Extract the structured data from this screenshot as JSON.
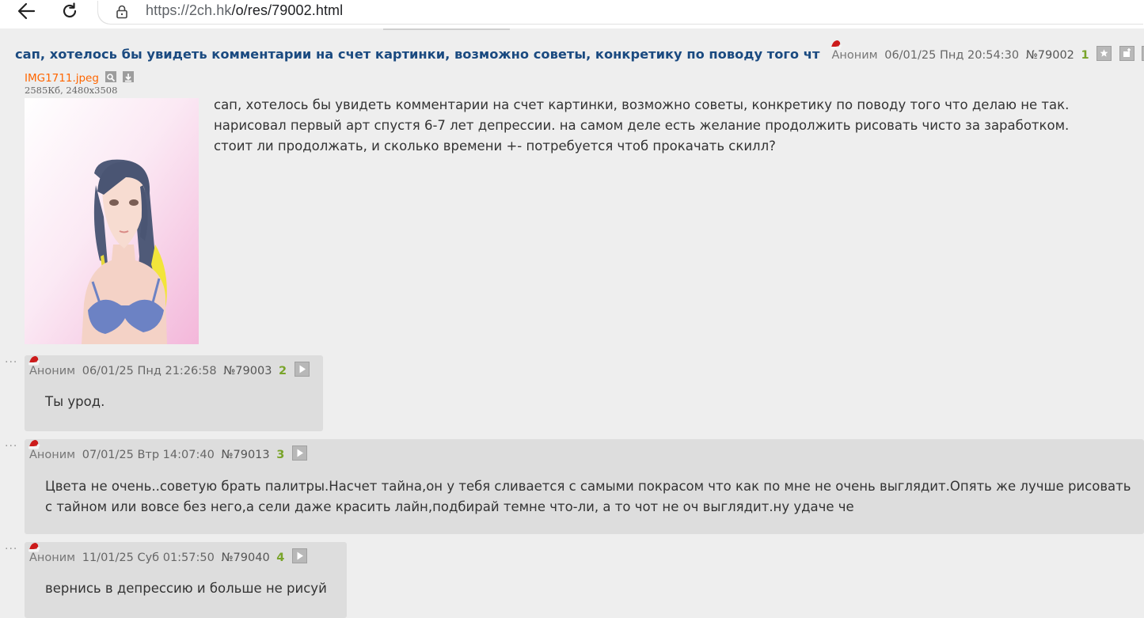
{
  "browser": {
    "url_host": "https://2ch.hk",
    "url_path": "/o/res/79002.html"
  },
  "op": {
    "subject": "сап, хотелось бы увидеть комментарии на счет картинки, возможно советы, конкретику по поводу того чт",
    "name": "Аноним",
    "datetime": "06/01/25 Пнд 20:54:30",
    "number": "№79002",
    "index": "1",
    "file_name": "IMG1711.jpeg",
    "file_size": "2585Кб, 2480x3508",
    "text": "сап, хотелось бы увидеть комментарии на счет картинки, возможно советы, конкретику по поводу того что делаю не так. нарисовал первый арт спустя 6-7 лет депрессии. на самом деле есть желание продолжить рисовать чисто за заработком. стоит ли продолжать, и сколько времени +- потребуется чтоб прокачать скилл?"
  },
  "replies": [
    {
      "name": "Аноним",
      "datetime": "06/01/25 Пнд 21:26:58",
      "number": "№79003",
      "index": "2",
      "text": "Ты урод."
    },
    {
      "name": "Аноним",
      "datetime": "07/01/25 Втр 14:07:40",
      "number": "№79013",
      "index": "3",
      "text": "Цвета не очень..советую брать палитры.Насчет тайна,он у тебя сливается с самыми покрасом что как по мне не очень выглядит.Опять же лучше рисовать с тайном или вовсе без него,а сели даже красить лайн,подбирай темне что-ли, а то чот не оч выглядит.ну удаче че"
    },
    {
      "name": "Аноним",
      "datetime": "11/01/25 Суб 01:57:50",
      "number": "№79040",
      "index": "4",
      "text": "вернись в депрессию и больше не рисуй"
    }
  ],
  "icons": {
    "back": "arrow-left-icon",
    "reload": "reload-icon",
    "lock": "lock-icon",
    "santa_hat": "santa-hat-icon",
    "favorite": "star-icon",
    "hide": "hide-icon",
    "reply": "play-icon",
    "search_image": "magnifier-icon",
    "download": "download-icon"
  },
  "colors": {
    "background": "#eeeeee",
    "reply_bg": "#dddddd",
    "subject": "#1a4a80",
    "file_link": "#ff6600",
    "reply_count": "#79a42a"
  }
}
